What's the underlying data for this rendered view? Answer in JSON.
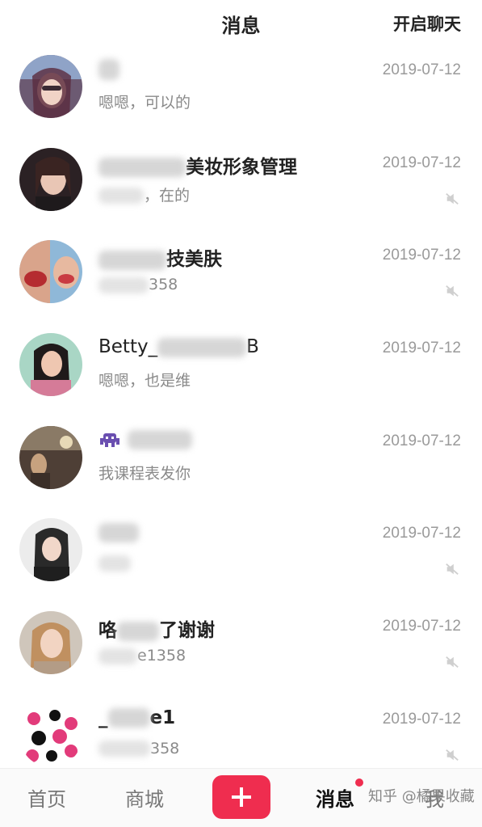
{
  "header": {
    "title": "消息",
    "right_action": "开启聊天"
  },
  "conversations": [
    {
      "name_visible": "",
      "message_visible": "嗯嗯，可以的",
      "date": "2019-07-12",
      "muted": false
    },
    {
      "name_visible": "美妆形象管理",
      "message_visible": "在的",
      "date": "2019-07-12",
      "muted": true
    },
    {
      "name_visible": "技美肤",
      "message_visible": "358",
      "date": "2019-07-12",
      "muted": true
    },
    {
      "name_visible": "Betty_",
      "name_suffix": "B",
      "message_visible": "嗯嗯，也是维",
      "date": "2019-07-12",
      "muted": false
    },
    {
      "name_visible": "",
      "message_visible": "我课程表发你",
      "date": "2019-07-12",
      "muted": false
    },
    {
      "name_visible": "",
      "message_visible": "",
      "date": "2019-07-12",
      "muted": true
    },
    {
      "name_visible": "咯",
      "name_suffix": "了谢谢",
      "message_visible": "e1358",
      "date": "2019-07-12",
      "muted": true
    },
    {
      "name_visible": "_",
      "name_suffix": "e1",
      "message_visible": "358",
      "date": "2019-07-12",
      "muted": true
    }
  ],
  "tabbar": {
    "home": "首页",
    "mall": "商城",
    "messages": "消息",
    "me": "我",
    "active": "messages",
    "accent_color": "#ef2d4f"
  },
  "watermark": "知乎 @橘果收藏"
}
